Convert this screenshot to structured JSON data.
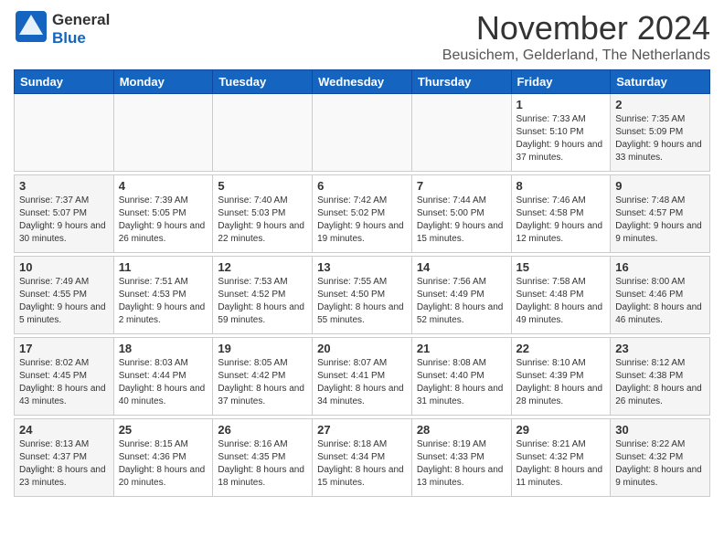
{
  "header": {
    "logo_line1": "General",
    "logo_line2": "Blue",
    "month_title": "November 2024",
    "subtitle": "Beusichem, Gelderland, The Netherlands"
  },
  "weekdays": [
    "Sunday",
    "Monday",
    "Tuesday",
    "Wednesday",
    "Thursday",
    "Friday",
    "Saturday"
  ],
  "weeks": [
    [
      {
        "day": "",
        "info": ""
      },
      {
        "day": "",
        "info": ""
      },
      {
        "day": "",
        "info": ""
      },
      {
        "day": "",
        "info": ""
      },
      {
        "day": "",
        "info": ""
      },
      {
        "day": "1",
        "info": "Sunrise: 7:33 AM\nSunset: 5:10 PM\nDaylight: 9 hours and 37 minutes."
      },
      {
        "day": "2",
        "info": "Sunrise: 7:35 AM\nSunset: 5:09 PM\nDaylight: 9 hours and 33 minutes."
      }
    ],
    [
      {
        "day": "3",
        "info": "Sunrise: 7:37 AM\nSunset: 5:07 PM\nDaylight: 9 hours and 30 minutes."
      },
      {
        "day": "4",
        "info": "Sunrise: 7:39 AM\nSunset: 5:05 PM\nDaylight: 9 hours and 26 minutes."
      },
      {
        "day": "5",
        "info": "Sunrise: 7:40 AM\nSunset: 5:03 PM\nDaylight: 9 hours and 22 minutes."
      },
      {
        "day": "6",
        "info": "Sunrise: 7:42 AM\nSunset: 5:02 PM\nDaylight: 9 hours and 19 minutes."
      },
      {
        "day": "7",
        "info": "Sunrise: 7:44 AM\nSunset: 5:00 PM\nDaylight: 9 hours and 15 minutes."
      },
      {
        "day": "8",
        "info": "Sunrise: 7:46 AM\nSunset: 4:58 PM\nDaylight: 9 hours and 12 minutes."
      },
      {
        "day": "9",
        "info": "Sunrise: 7:48 AM\nSunset: 4:57 PM\nDaylight: 9 hours and 9 minutes."
      }
    ],
    [
      {
        "day": "10",
        "info": "Sunrise: 7:49 AM\nSunset: 4:55 PM\nDaylight: 9 hours and 5 minutes."
      },
      {
        "day": "11",
        "info": "Sunrise: 7:51 AM\nSunset: 4:53 PM\nDaylight: 9 hours and 2 minutes."
      },
      {
        "day": "12",
        "info": "Sunrise: 7:53 AM\nSunset: 4:52 PM\nDaylight: 8 hours and 59 minutes."
      },
      {
        "day": "13",
        "info": "Sunrise: 7:55 AM\nSunset: 4:50 PM\nDaylight: 8 hours and 55 minutes."
      },
      {
        "day": "14",
        "info": "Sunrise: 7:56 AM\nSunset: 4:49 PM\nDaylight: 8 hours and 52 minutes."
      },
      {
        "day": "15",
        "info": "Sunrise: 7:58 AM\nSunset: 4:48 PM\nDaylight: 8 hours and 49 minutes."
      },
      {
        "day": "16",
        "info": "Sunrise: 8:00 AM\nSunset: 4:46 PM\nDaylight: 8 hours and 46 minutes."
      }
    ],
    [
      {
        "day": "17",
        "info": "Sunrise: 8:02 AM\nSunset: 4:45 PM\nDaylight: 8 hours and 43 minutes."
      },
      {
        "day": "18",
        "info": "Sunrise: 8:03 AM\nSunset: 4:44 PM\nDaylight: 8 hours and 40 minutes."
      },
      {
        "day": "19",
        "info": "Sunrise: 8:05 AM\nSunset: 4:42 PM\nDaylight: 8 hours and 37 minutes."
      },
      {
        "day": "20",
        "info": "Sunrise: 8:07 AM\nSunset: 4:41 PM\nDaylight: 8 hours and 34 minutes."
      },
      {
        "day": "21",
        "info": "Sunrise: 8:08 AM\nSunset: 4:40 PM\nDaylight: 8 hours and 31 minutes."
      },
      {
        "day": "22",
        "info": "Sunrise: 8:10 AM\nSunset: 4:39 PM\nDaylight: 8 hours and 28 minutes."
      },
      {
        "day": "23",
        "info": "Sunrise: 8:12 AM\nSunset: 4:38 PM\nDaylight: 8 hours and 26 minutes."
      }
    ],
    [
      {
        "day": "24",
        "info": "Sunrise: 8:13 AM\nSunset: 4:37 PM\nDaylight: 8 hours and 23 minutes."
      },
      {
        "day": "25",
        "info": "Sunrise: 8:15 AM\nSunset: 4:36 PM\nDaylight: 8 hours and 20 minutes."
      },
      {
        "day": "26",
        "info": "Sunrise: 8:16 AM\nSunset: 4:35 PM\nDaylight: 8 hours and 18 minutes."
      },
      {
        "day": "27",
        "info": "Sunrise: 8:18 AM\nSunset: 4:34 PM\nDaylight: 8 hours and 15 minutes."
      },
      {
        "day": "28",
        "info": "Sunrise: 8:19 AM\nSunset: 4:33 PM\nDaylight: 8 hours and 13 minutes."
      },
      {
        "day": "29",
        "info": "Sunrise: 8:21 AM\nSunset: 4:32 PM\nDaylight: 8 hours and 11 minutes."
      },
      {
        "day": "30",
        "info": "Sunrise: 8:22 AM\nSunset: 4:32 PM\nDaylight: 8 hours and 9 minutes."
      }
    ]
  ]
}
